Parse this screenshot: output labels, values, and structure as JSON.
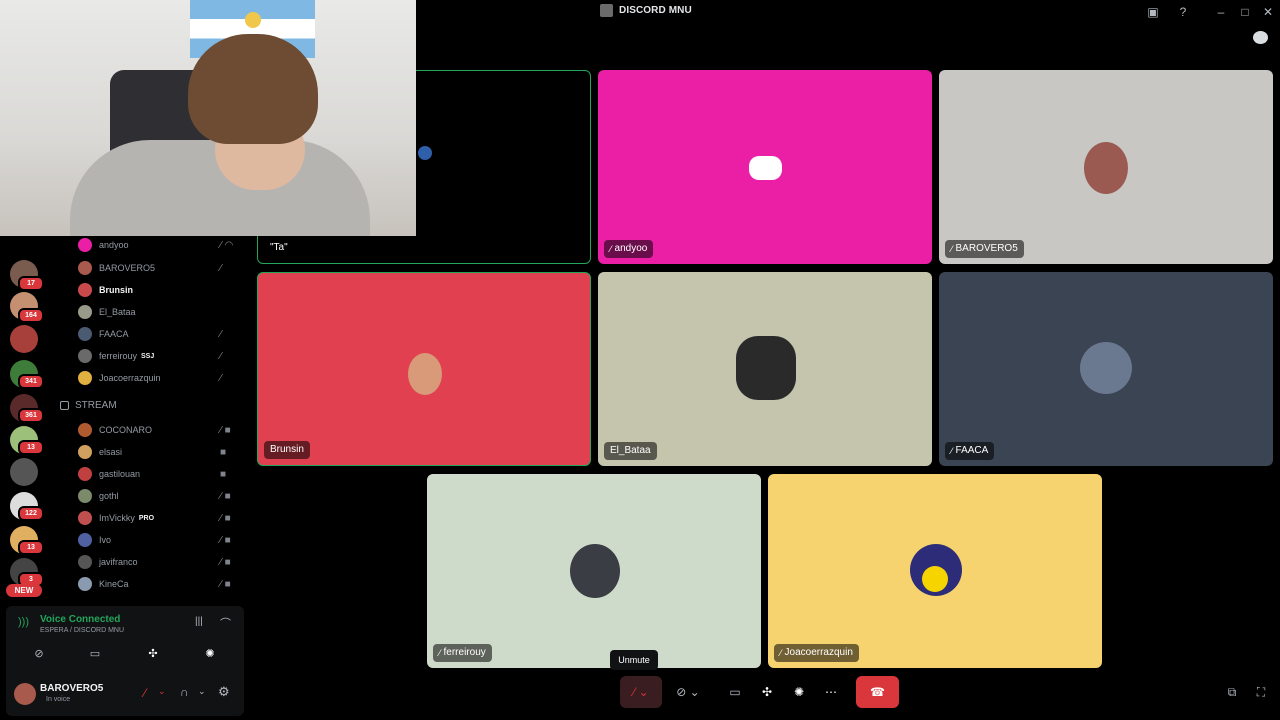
{
  "app": {
    "title": "DISCORD MNU"
  },
  "servers": {
    "badges": [
      "17",
      "164",
      "341",
      "361",
      "13",
      "122",
      "13",
      "3"
    ],
    "new_label": "NEW"
  },
  "channel_list": {
    "members_top": [
      {
        "name": "andyoo",
        "active": false,
        "tag": ""
      },
      {
        "name": "BAROVERO5",
        "active": false,
        "tag": ""
      },
      {
        "name": "Brunsin",
        "active": true,
        "tag": ""
      },
      {
        "name": "El_Bataa",
        "active": false,
        "tag": ""
      },
      {
        "name": "FAACA",
        "active": false,
        "tag": ""
      },
      {
        "name": "ferreirouy",
        "active": false,
        "tag": "SSJ"
      },
      {
        "name": "Joacoerrazquin",
        "active": false,
        "tag": ""
      }
    ],
    "stream_category": "STREAM",
    "stream_members": [
      {
        "name": "COCONARO",
        "tag": ""
      },
      {
        "name": "elsasi",
        "tag": ""
      },
      {
        "name": "gastilouan",
        "tag": ""
      },
      {
        "name": "gothl",
        "tag": ""
      },
      {
        "name": "ImVickky",
        "tag": "PRO"
      },
      {
        "name": "Ivo",
        "tag": ""
      },
      {
        "name": "javifranco",
        "tag": ""
      },
      {
        "name": "KineCa",
        "tag": ""
      }
    ]
  },
  "voice_panel": {
    "status": "Voice Connected",
    "channel": "ESPERA / DISCORD MNU"
  },
  "user_panel": {
    "name": "BAROVERO5",
    "status": "In voice"
  },
  "video_tiles": [
    {
      "label": "\"Ta\"",
      "bg": "#000000",
      "muted": false
    },
    {
      "label": "andyoo",
      "bg": "#eb1ea6",
      "muted": true
    },
    {
      "label": "BAROVERO5",
      "bg": "#c9c7c3",
      "muted": true
    },
    {
      "label": "Brunsin",
      "bg": "#e0404f",
      "muted": false
    },
    {
      "label": "El_Bataa",
      "bg": "#c5c4ad",
      "muted": false
    },
    {
      "label": "FAACA",
      "bg": "#3b4452",
      "muted": true
    },
    {
      "label": "ferreirouy",
      "bg": "#cedbcb",
      "muted": true
    },
    {
      "label": "Joacoerrazquin",
      "bg": "#f6d36f",
      "muted": true
    }
  ],
  "controls": {
    "tooltip": "Unmute"
  },
  "colors": {
    "accent_green": "#23a55a",
    "danger_red": "#da373c"
  }
}
